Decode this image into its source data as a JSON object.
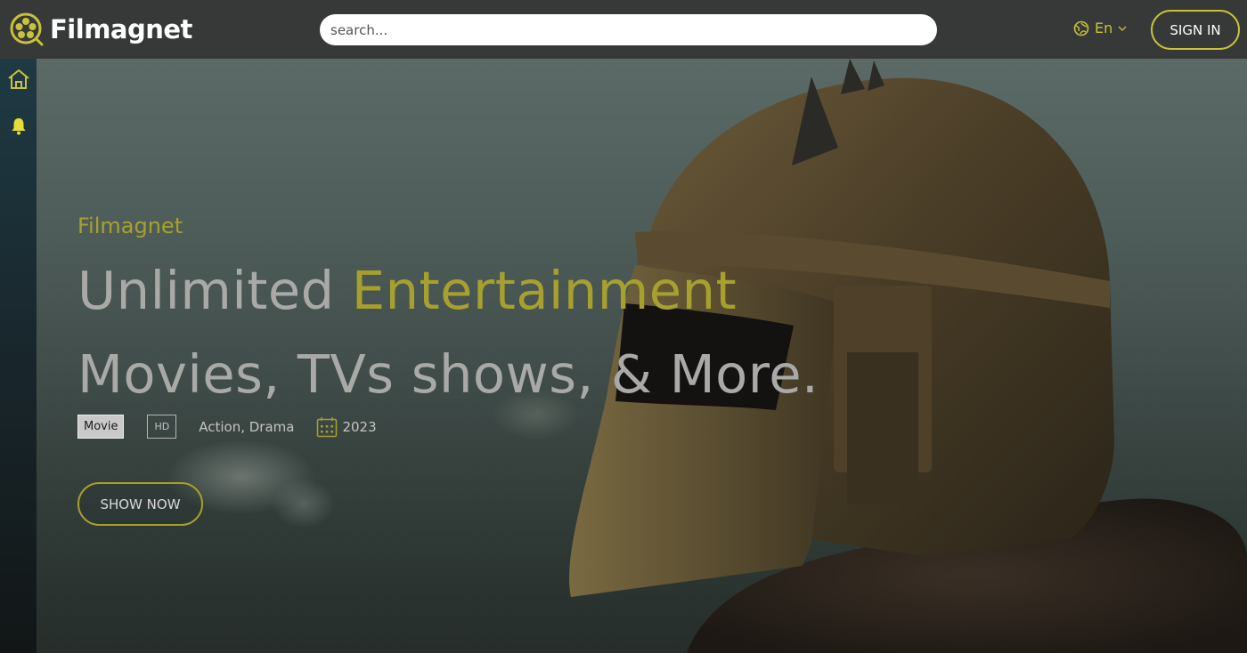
{
  "header": {
    "brand_name": "Filmagnet",
    "search_placeholder": "search...",
    "language": "En",
    "signin_label": "SIGN IN"
  },
  "sidebar": {
    "items": [
      {
        "icon": "home-icon"
      },
      {
        "icon": "bell-icon"
      }
    ]
  },
  "hero": {
    "eyebrow": "Filmagnet",
    "headline_line1_plain": "Unlimited ",
    "headline_line1_accent": "Entertainment",
    "headline_line2": "Movies, TVs shows, & More.",
    "type_badge": "Movie",
    "quality_badge": "HD",
    "genres": "Action, Drama",
    "year": "2023",
    "cta_label": "SHOW NOW"
  },
  "colors": {
    "accent": "#c8c23a",
    "accent_dim": "#a8a02e",
    "topbar": "#373838"
  }
}
